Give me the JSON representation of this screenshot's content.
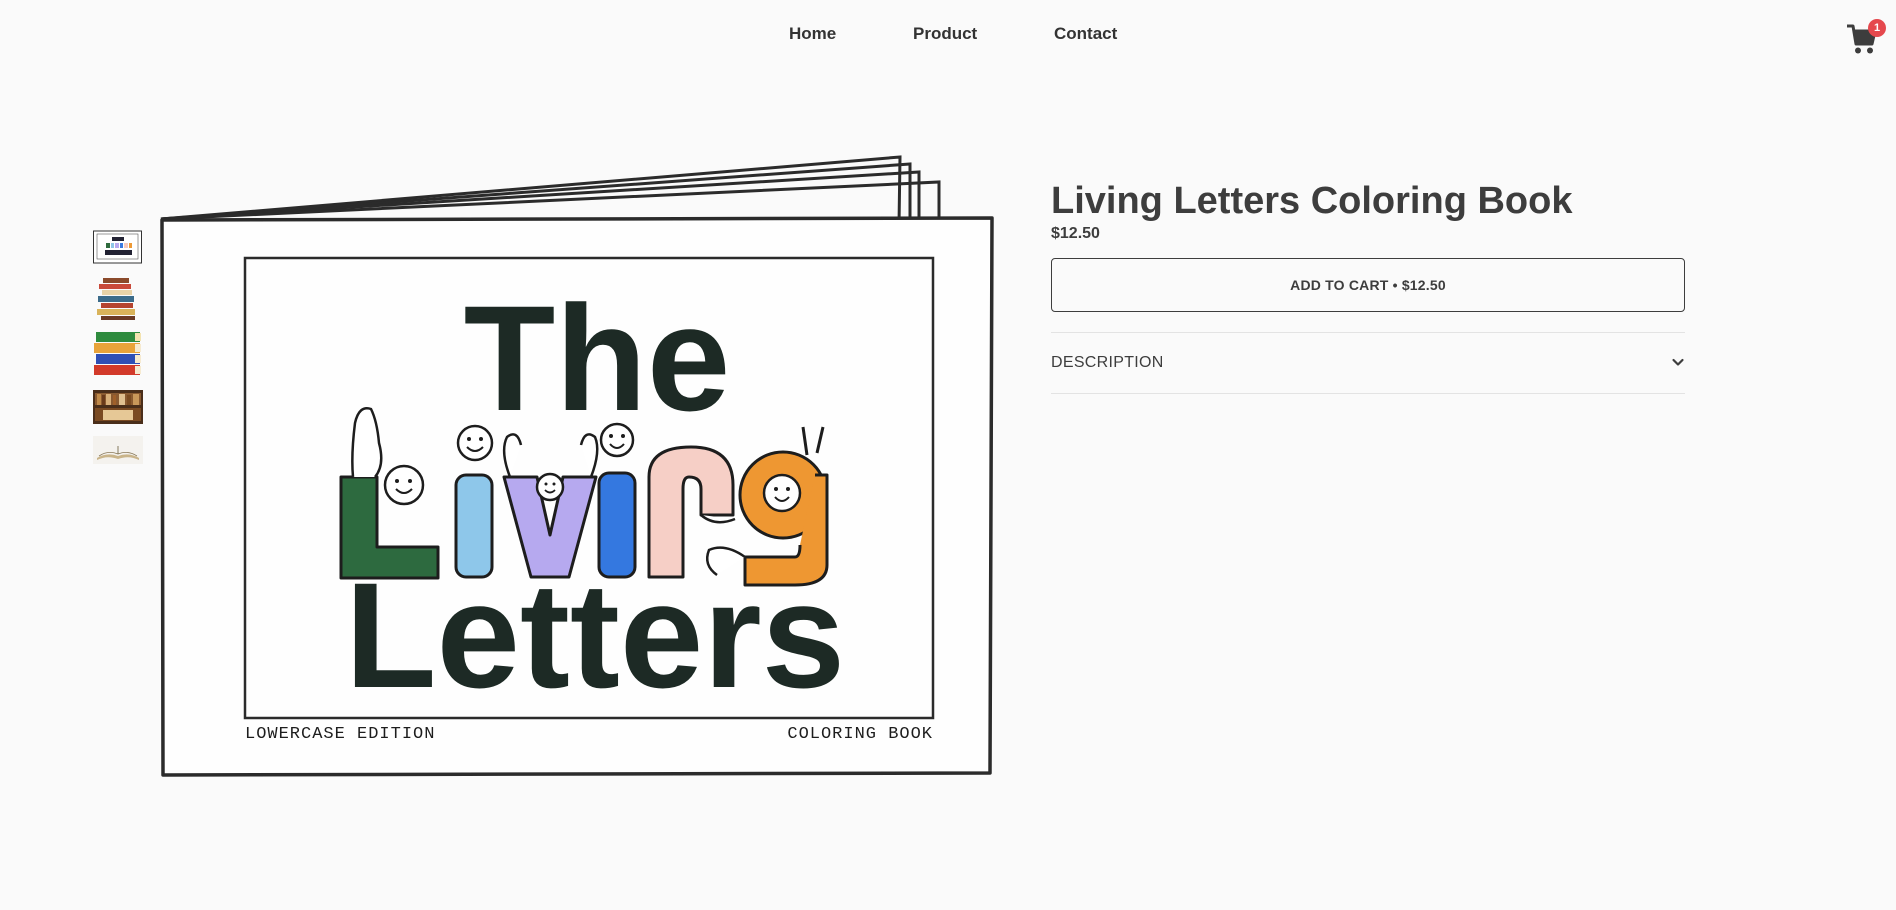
{
  "nav": {
    "home": "Home",
    "product": "Product",
    "contact": "Contact"
  },
  "cart": {
    "icon": "cart-icon",
    "count": "1"
  },
  "product": {
    "title": "Living Letters Coloring Book",
    "price": "$12.50",
    "add_to_cart": "ADD TO CART • $12.50",
    "description_label": "DESCRIPTION"
  },
  "cover": {
    "line1": "The",
    "line2": "Living",
    "line3": "Letters",
    "bottom_left": "LOWERCASE EDITION",
    "bottom_right": "COLORING BOOK"
  },
  "thumbnails": [
    "book-cover-thumbnail",
    "book-stack-thumbnail",
    "colored-books-thumbnail",
    "bookshelf-thumbnail",
    "open-book-thumbnail"
  ]
}
